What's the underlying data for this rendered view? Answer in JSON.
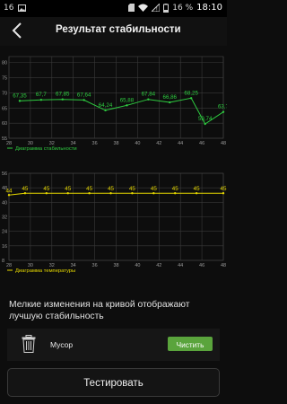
{
  "status_bar": {
    "left_label": "16",
    "battery_percent": "16 %",
    "time": "18:10",
    "icons": [
      "image-icon",
      "sd-card-icon",
      "wifi-icon",
      "no-sim-icon",
      "battery-icon"
    ]
  },
  "header": {
    "title": "Результат стабильности",
    "back_icon": "back-arrow-icon"
  },
  "chart_data": [
    {
      "type": "line",
      "legend": "Диаграмма стабильности",
      "x_ticks": [
        "28",
        "30",
        "32",
        "34",
        "36",
        "38",
        "40",
        "42",
        "44",
        "46",
        "48"
      ],
      "y_ticks": [
        "55",
        "60",
        "65",
        "70",
        "75",
        "80"
      ],
      "ylim": [
        55,
        82
      ],
      "xlim": [
        28,
        48
      ],
      "line_color": "#2ecc40",
      "series": [
        {
          "values": [
            {
              "x": 29,
              "y": 67.35
            },
            {
              "x": 31,
              "y": 67.7
            },
            {
              "x": 33,
              "y": 67.85
            },
            {
              "x": 35,
              "y": 67.64
            },
            {
              "x": 37,
              "y": 64.24
            },
            {
              "x": 39,
              "y": 65.88
            },
            {
              "x": 41,
              "y": 67.84
            },
            {
              "x": 43,
              "y": 66.86
            },
            {
              "x": 45,
              "y": 68.25
            },
            {
              "x": 46.3,
              "y": 59.74
            },
            {
              "x": 48,
              "y": 63.7
            }
          ]
        }
      ],
      "labels": [
        "67,35",
        "67,7",
        "67,85",
        "67,64",
        "64,24",
        "65,88",
        "67,84",
        "66,86",
        "68,25",
        "59,74",
        "63,7"
      ]
    },
    {
      "type": "line",
      "legend": "Диаграмма температуры",
      "x_ticks": [
        "28",
        "30",
        "32",
        "34",
        "36",
        "38",
        "40",
        "42",
        "44",
        "46",
        "48"
      ],
      "y_ticks": [
        "8",
        "16",
        "24",
        "32",
        "40",
        "48",
        "56"
      ],
      "ylim": [
        8,
        56
      ],
      "xlim": [
        28,
        48
      ],
      "line_color": "#e6d800",
      "series": [
        {
          "values": [
            {
              "x": 28,
              "y": 44
            },
            {
              "x": 29.5,
              "y": 45
            },
            {
              "x": 31.5,
              "y": 45
            },
            {
              "x": 33.5,
              "y": 45
            },
            {
              "x": 35.5,
              "y": 45
            },
            {
              "x": 37.5,
              "y": 45
            },
            {
              "x": 39.5,
              "y": 45
            },
            {
              "x": 41.5,
              "y": 45
            },
            {
              "x": 43.5,
              "y": 45
            },
            {
              "x": 45.5,
              "y": 45
            },
            {
              "x": 48,
              "y": 45
            }
          ]
        }
      ],
      "labels": [
        "44",
        "45",
        "45",
        "45",
        "45",
        "45",
        "45",
        "45",
        "45",
        "45",
        "45"
      ]
    }
  ],
  "note": "Мелкие изменения на кривой отображают лучшую стабильность",
  "trash": {
    "icon": "trash-icon",
    "label": "Мусор",
    "button_label": "Чистить"
  },
  "test_button_label": "Тестировать"
}
